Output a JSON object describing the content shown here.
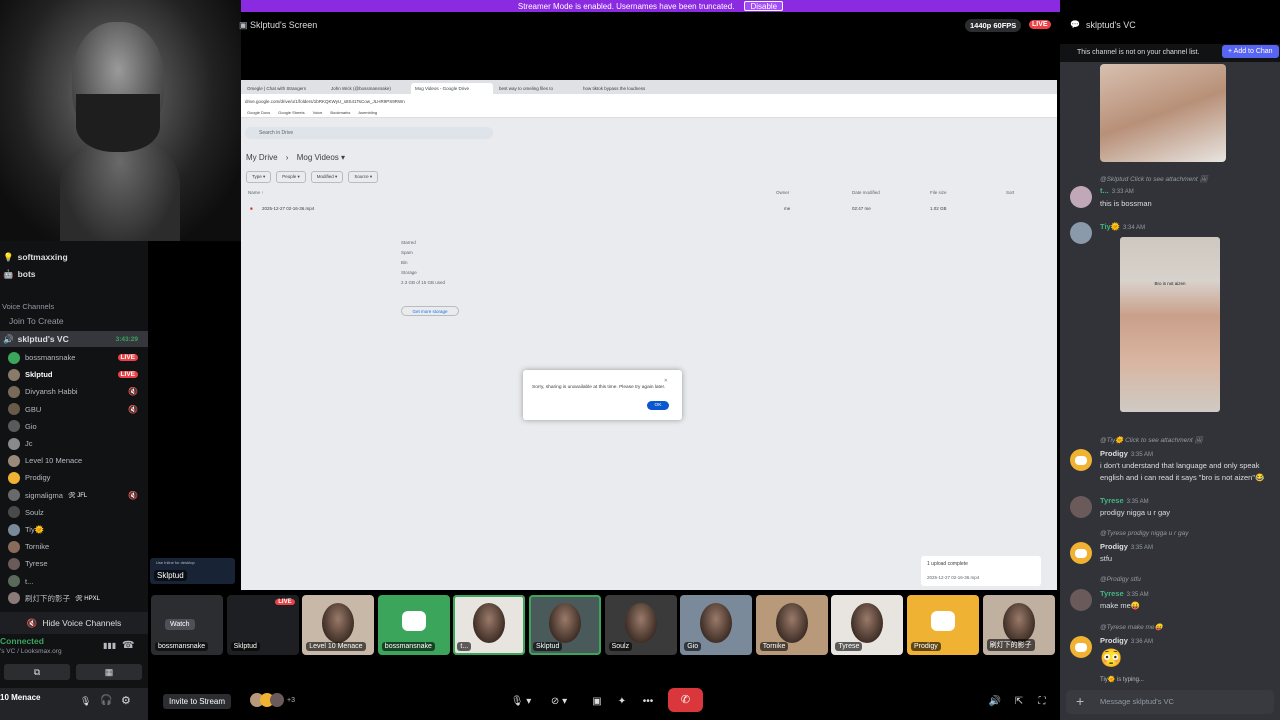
{
  "banner": {
    "text": "Streamer Mode is enabled. Usernames have been truncated.",
    "disable_label": "Disable"
  },
  "sidebar": {
    "text_channels": [
      {
        "icon": "💡",
        "name": "softmaxxing"
      },
      {
        "icon": "🤖",
        "name": "bots"
      }
    ],
    "voice_category": "Voice Channels",
    "join_to_create": "Join To Create",
    "vc_name": "sklptud's VC",
    "vc_time": "3:43:29",
    "voice_users": [
      {
        "name": "bossmansnake",
        "live": true,
        "color": "#3ba55c"
      },
      {
        "name": "Sklptud",
        "live": true,
        "color": "#8a7a6a",
        "bold": true
      },
      {
        "name": "Divyansh Habbi",
        "muted": true,
        "color": "#7a6a5a"
      },
      {
        "name": "GBU",
        "muted": true,
        "color": "#6a5a4a"
      },
      {
        "name": "Gio",
        "color": "#5a5a5a"
      },
      {
        "name": "Jc",
        "color": "#8a8a8a"
      },
      {
        "name": "Level 10 Menace",
        "color": "#9a8a7a"
      },
      {
        "name": "Prodigy",
        "color": "#f0b232"
      },
      {
        "name": "sigmaligma",
        "tag": "🛠 JFL",
        "muted": true,
        "color": "#6a6a6a"
      },
      {
        "name": "Soulz",
        "color": "#4a4a4a"
      },
      {
        "name": "Tiy🌞",
        "color": "#7a8a9a"
      },
      {
        "name": "Tornike",
        "color": "#8a6a5a"
      },
      {
        "name": "Tyrese",
        "color": "#6a5a5a"
      },
      {
        "name": "t...",
        "color": "#5a6a5a"
      },
      {
        "name": "刷灯下的影子",
        "tag": "🛠 HPXL",
        "color": "#8a7a7a"
      }
    ],
    "hide_voice": "Hide Voice Channels",
    "connected": "Connected",
    "connected_sub": "'s VC / Looksmax.org",
    "user_name": "10 Menace"
  },
  "stage": {
    "title": "Sklptud's Screen",
    "quality": "1440p 60FPS",
    "live": "LIVE",
    "browser": {
      "tabs": [
        "Omegle | Chat with Strangers",
        "John Wick (@bossmansnake)",
        "Mog Videos - Google Drive",
        "best way to omeling files to",
        "how tiktok bypass the loudness"
      ],
      "url": "drive.google.com/drive/u/1/folders/1bRKQKWyU_s8S41TsCow_JLHR9PS9RWn",
      "bookmarks": [
        "Google Docs",
        "Google Sheets",
        "Voice",
        "Bookmarks",
        "Asembling"
      ],
      "search_placeholder": "Search in Drive",
      "breadcrumb_root": "My Drive",
      "breadcrumb_folder": "Mog Videos ▾",
      "chips": [
        "Type ▾",
        "People ▾",
        "Modified ▾",
        "Source ▾"
      ],
      "columns": [
        "Name ↑",
        "Owner",
        "Date modified",
        "File size",
        "Sort"
      ],
      "file": {
        "name": "2025-12-27 02-16-36.mp4",
        "owner": "me",
        "modified": "02:47 me",
        "size": "1.02 GB"
      },
      "sidebar_items": [
        "Starred",
        "Spam",
        "Bin",
        "Storage"
      ],
      "storage_text": "2.3 GB of 15 GB used",
      "get_storage": "Get more storage",
      "dialog_msg": "Sorry, sharing is unavailable at this time. Please try again later.",
      "dialog_ok": "OK",
      "upload_title": "1 upload complete",
      "upload_file": "2025-12-27 02-16-36.mp4"
    },
    "promo_text": "Use Inline for desktop",
    "promo_name": "Sklptud",
    "tiles": [
      {
        "name": "bossmansnake",
        "watch": "Watch",
        "color": "#2b2d31"
      },
      {
        "name": "Sklptud",
        "live": "LIVE",
        "color": "#1e1f22"
      },
      {
        "name": "Level 10 Menace",
        "color": "#c8b8a8"
      },
      {
        "name": "bossmansnake",
        "color": "#3ba55c",
        "discord": true
      },
      {
        "name": "t...",
        "color": "#e8e4e0"
      },
      {
        "name": "Sklptud",
        "color": "#4a5a5a"
      },
      {
        "name": "Soulz",
        "color": "#3a3a3a"
      },
      {
        "name": "Gio",
        "color": "#7a8a9a"
      },
      {
        "name": "Tornike",
        "color": "#b89a7a"
      },
      {
        "name": "Tyrese",
        "color": "#e8e4e0"
      },
      {
        "name": "Prodigy",
        "color": "#f0b232",
        "discord": true
      },
      {
        "name": "刷灯下的影子",
        "color": "#c0b0a0"
      }
    ],
    "invite": "Invite to Stream",
    "plus_count": "+3"
  },
  "chat": {
    "title": "sklptud's VC",
    "not_on_list": "This channel is not on your channel list.",
    "add_channel": "+ Add to Chan",
    "messages": [
      {
        "reply": "@Sklptud Click to see attachment",
        "user": "t...",
        "time": "3:33 AM",
        "text": "this is bossman"
      },
      {
        "user": "Tiy🌞",
        "time": "3:34 AM",
        "image_caption": "Bro is not aizen"
      },
      {
        "reply": "@Tiy🌞 Click to see attachment",
        "user": "Prodigy",
        "time": "3:35 AM",
        "text1": "i don't understand that language and only speak",
        "text2": "english and i can read it says \"bro is not aizen\"😂"
      },
      {
        "user": "Tyrese",
        "time": "3:35 AM",
        "text": "prodigy nigga u r gay"
      },
      {
        "reply": "@Tyrese prodigy nigga u r gay",
        "user": "Prodigy",
        "time": "3:35 AM",
        "text": "stfu"
      },
      {
        "reply": "@Prodigy stfu",
        "user": "Tyrese",
        "time": "3:35 AM",
        "text": "make me😛"
      },
      {
        "reply": "@Tyrese make me😛",
        "user": "Prodigy",
        "time": "3:36 AM",
        "text": "😳"
      }
    ],
    "typing": "Tiy🌞 is typing...",
    "input_placeholder": "Message sklptud's VC"
  }
}
